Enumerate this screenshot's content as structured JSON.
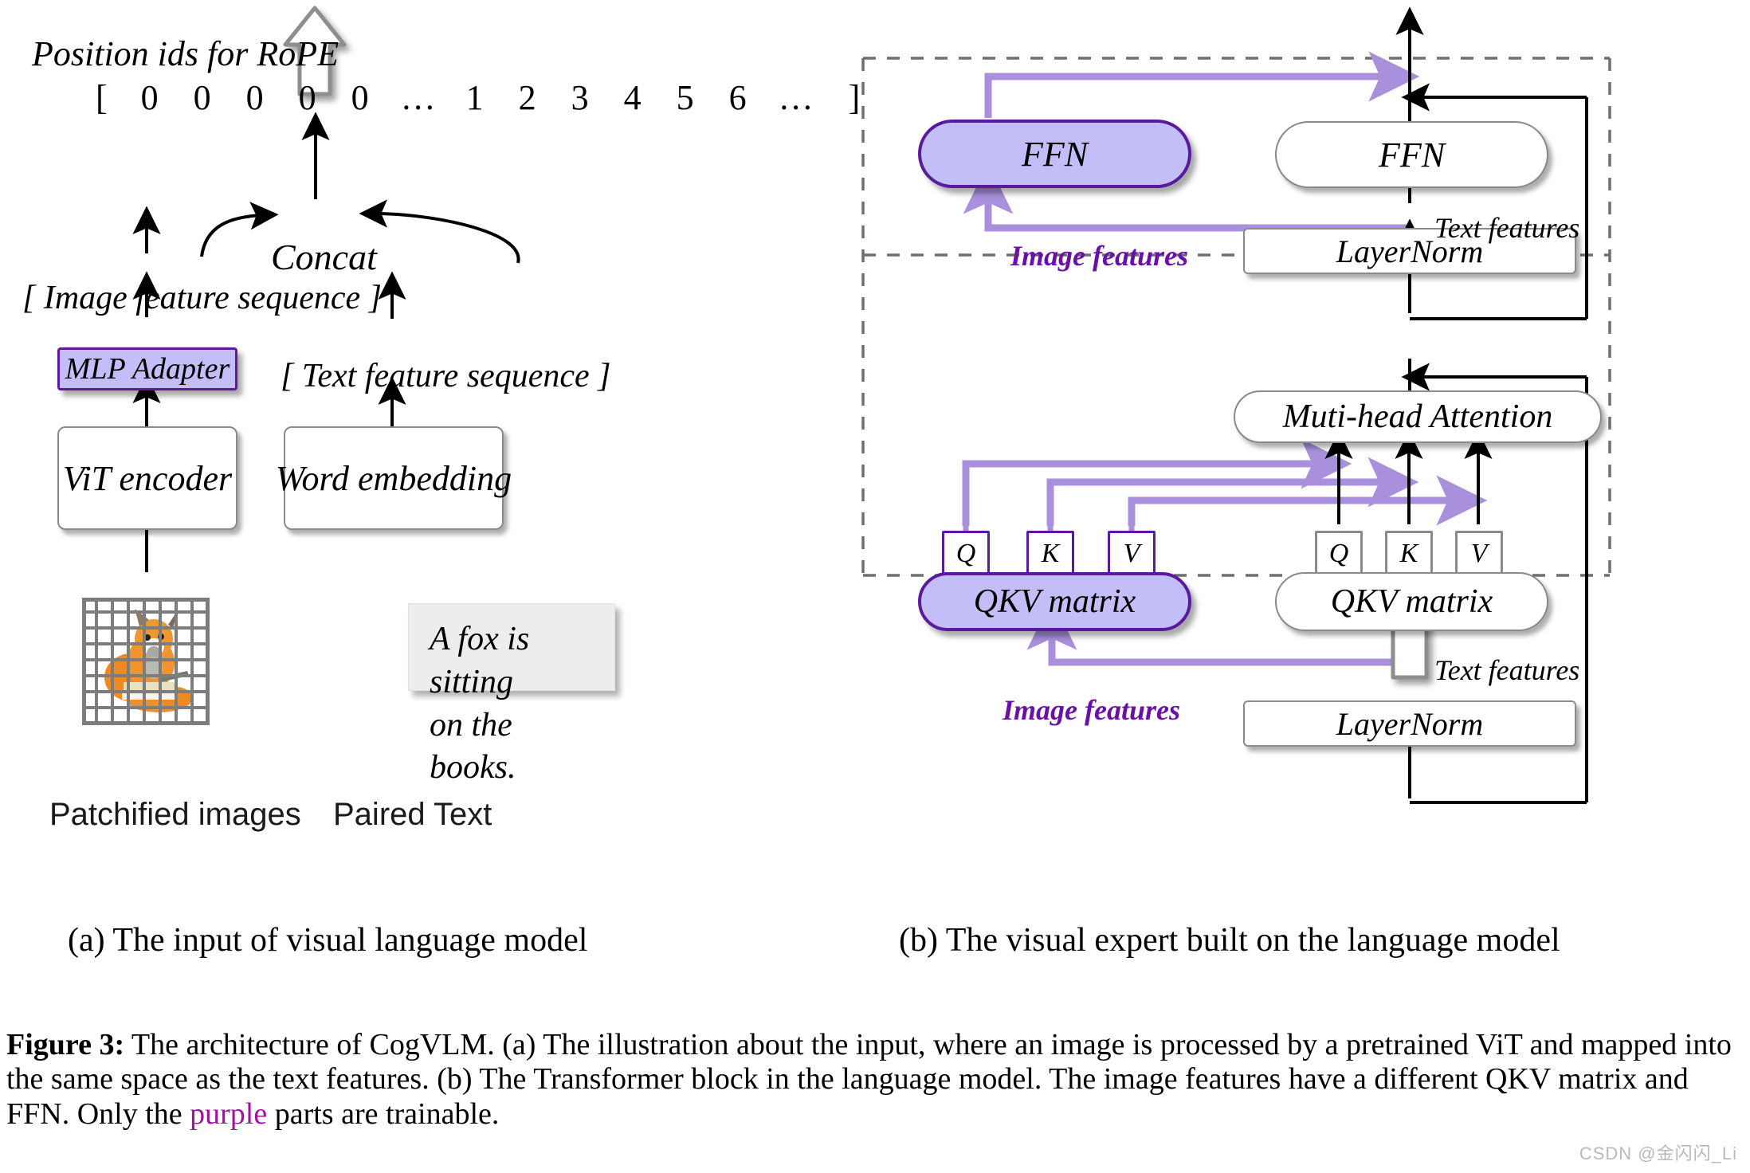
{
  "figure": {
    "label": "Figure 3:",
    "caption_part1": " The architecture of CogVLM. (a) The illustration about the input, where an image is processed by a pretrained ViT and mapped into the same space as the text features. (b) The Transformer block in the language model. The image features have a different QKV matrix and FFN. Only the ",
    "purple_word": "purple",
    "caption_part2": " parts are trainable.",
    "watermark": "CSDN @金闪闪_Li"
  },
  "colors": {
    "purple_fill": "#C4BEF8",
    "purple_border": "#5B1A9E",
    "purple_arrow": "#A990DC",
    "purple_text": "#6A10A8",
    "caption_purple": "#A211A2",
    "box_border": "#8a8a8a",
    "textbox_bg": "#eceded"
  },
  "panel_a": {
    "subcaption": "(a) The input of visual language model",
    "rope_label": "Position ids for RoPE",
    "position_ids": {
      "open_bracket": "[",
      "tokens": [
        "0",
        "0",
        "0",
        "0",
        "0",
        "…",
        "1",
        "2",
        "3",
        "4",
        "5",
        "6",
        "…"
      ],
      "close_bracket": "]"
    },
    "concat_label": "Concat",
    "image_feature_sequence": "[ Image feature sequence ]",
    "text_feature_sequence": "[ Text  feature sequence ]",
    "mlp_adapter": "MLP Adapter",
    "vit_encoder": "ViT encoder",
    "word_embedding": "Word embedding",
    "paired_text_line1": "A fox is sitting",
    "paired_text_line2": "on the books.",
    "patchified_label": "Patchified images",
    "paired_text_label": "Paired Text"
  },
  "panel_b": {
    "subcaption": "(b) The visual expert built on the language model",
    "ffn_image": "FFN",
    "ffn_text": "FFN",
    "layernorm_top": "LayerNorm",
    "layernorm_bottom": "LayerNorm",
    "attention": "Muti-head Attention",
    "qkv_matrix_image": "QKV matrix",
    "qkv_matrix_text": "QKV matrix",
    "qkv_image": [
      "Q",
      "K",
      "V"
    ],
    "qkv_text": [
      "Q",
      "K",
      "V"
    ],
    "image_features_top": "Image features",
    "text_features_top": "Text features",
    "image_features_bottom": "Image features",
    "text_features_bottom": "Text features"
  }
}
